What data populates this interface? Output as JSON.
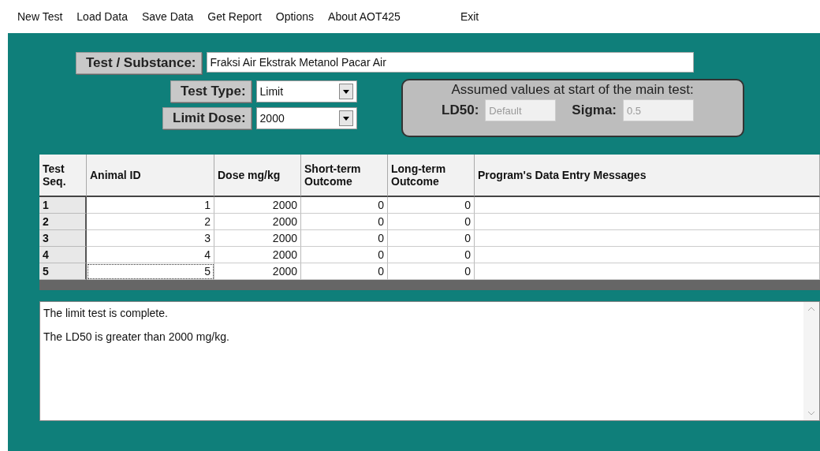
{
  "menu": [
    "New Test",
    "Load Data",
    "Save Data",
    "Get Report",
    "Options",
    "About AOT425",
    "Exit"
  ],
  "substance": {
    "label": "Test / Substance:",
    "value": "Fraksi Air Ekstrak Metanol Pacar Air"
  },
  "test_type": {
    "label": "Test Type:",
    "value": "Limit"
  },
  "limit_dose": {
    "label": "Limit Dose:",
    "value": "2000"
  },
  "assumed": {
    "title": "Assumed values at start of the main test:",
    "ld50": {
      "label": "LD50:",
      "value": "Default",
      "disabled": true
    },
    "sigma": {
      "label": "Sigma:",
      "value": "0.5",
      "disabled": true
    }
  },
  "table": {
    "columns": [
      "Test Seq.",
      "Animal ID",
      "Dose mg/kg",
      "Short-term Outcome",
      "Long-term Outcome",
      "Program's Data Entry Messages"
    ],
    "rows": [
      {
        "seq": "1",
        "animal_id": "1",
        "dose": "2000",
        "short_term": "0",
        "long_term": "0",
        "focused": false
      },
      {
        "seq": "2",
        "animal_id": "2",
        "dose": "2000",
        "short_term": "0",
        "long_term": "0",
        "focused": false
      },
      {
        "seq": "3",
        "animal_id": "3",
        "dose": "2000",
        "short_term": "0",
        "long_term": "0",
        "focused": false
      },
      {
        "seq": "4",
        "animal_id": "4",
        "dose": "2000",
        "short_term": "0",
        "long_term": "0",
        "focused": false
      },
      {
        "seq": "5",
        "animal_id": "5",
        "dose": "2000",
        "short_term": "0",
        "long_term": "0",
        "focused": true
      }
    ]
  },
  "messages": [
    "The limit test is complete.",
    "The LD50 is greater than 2000 mg/kg."
  ]
}
